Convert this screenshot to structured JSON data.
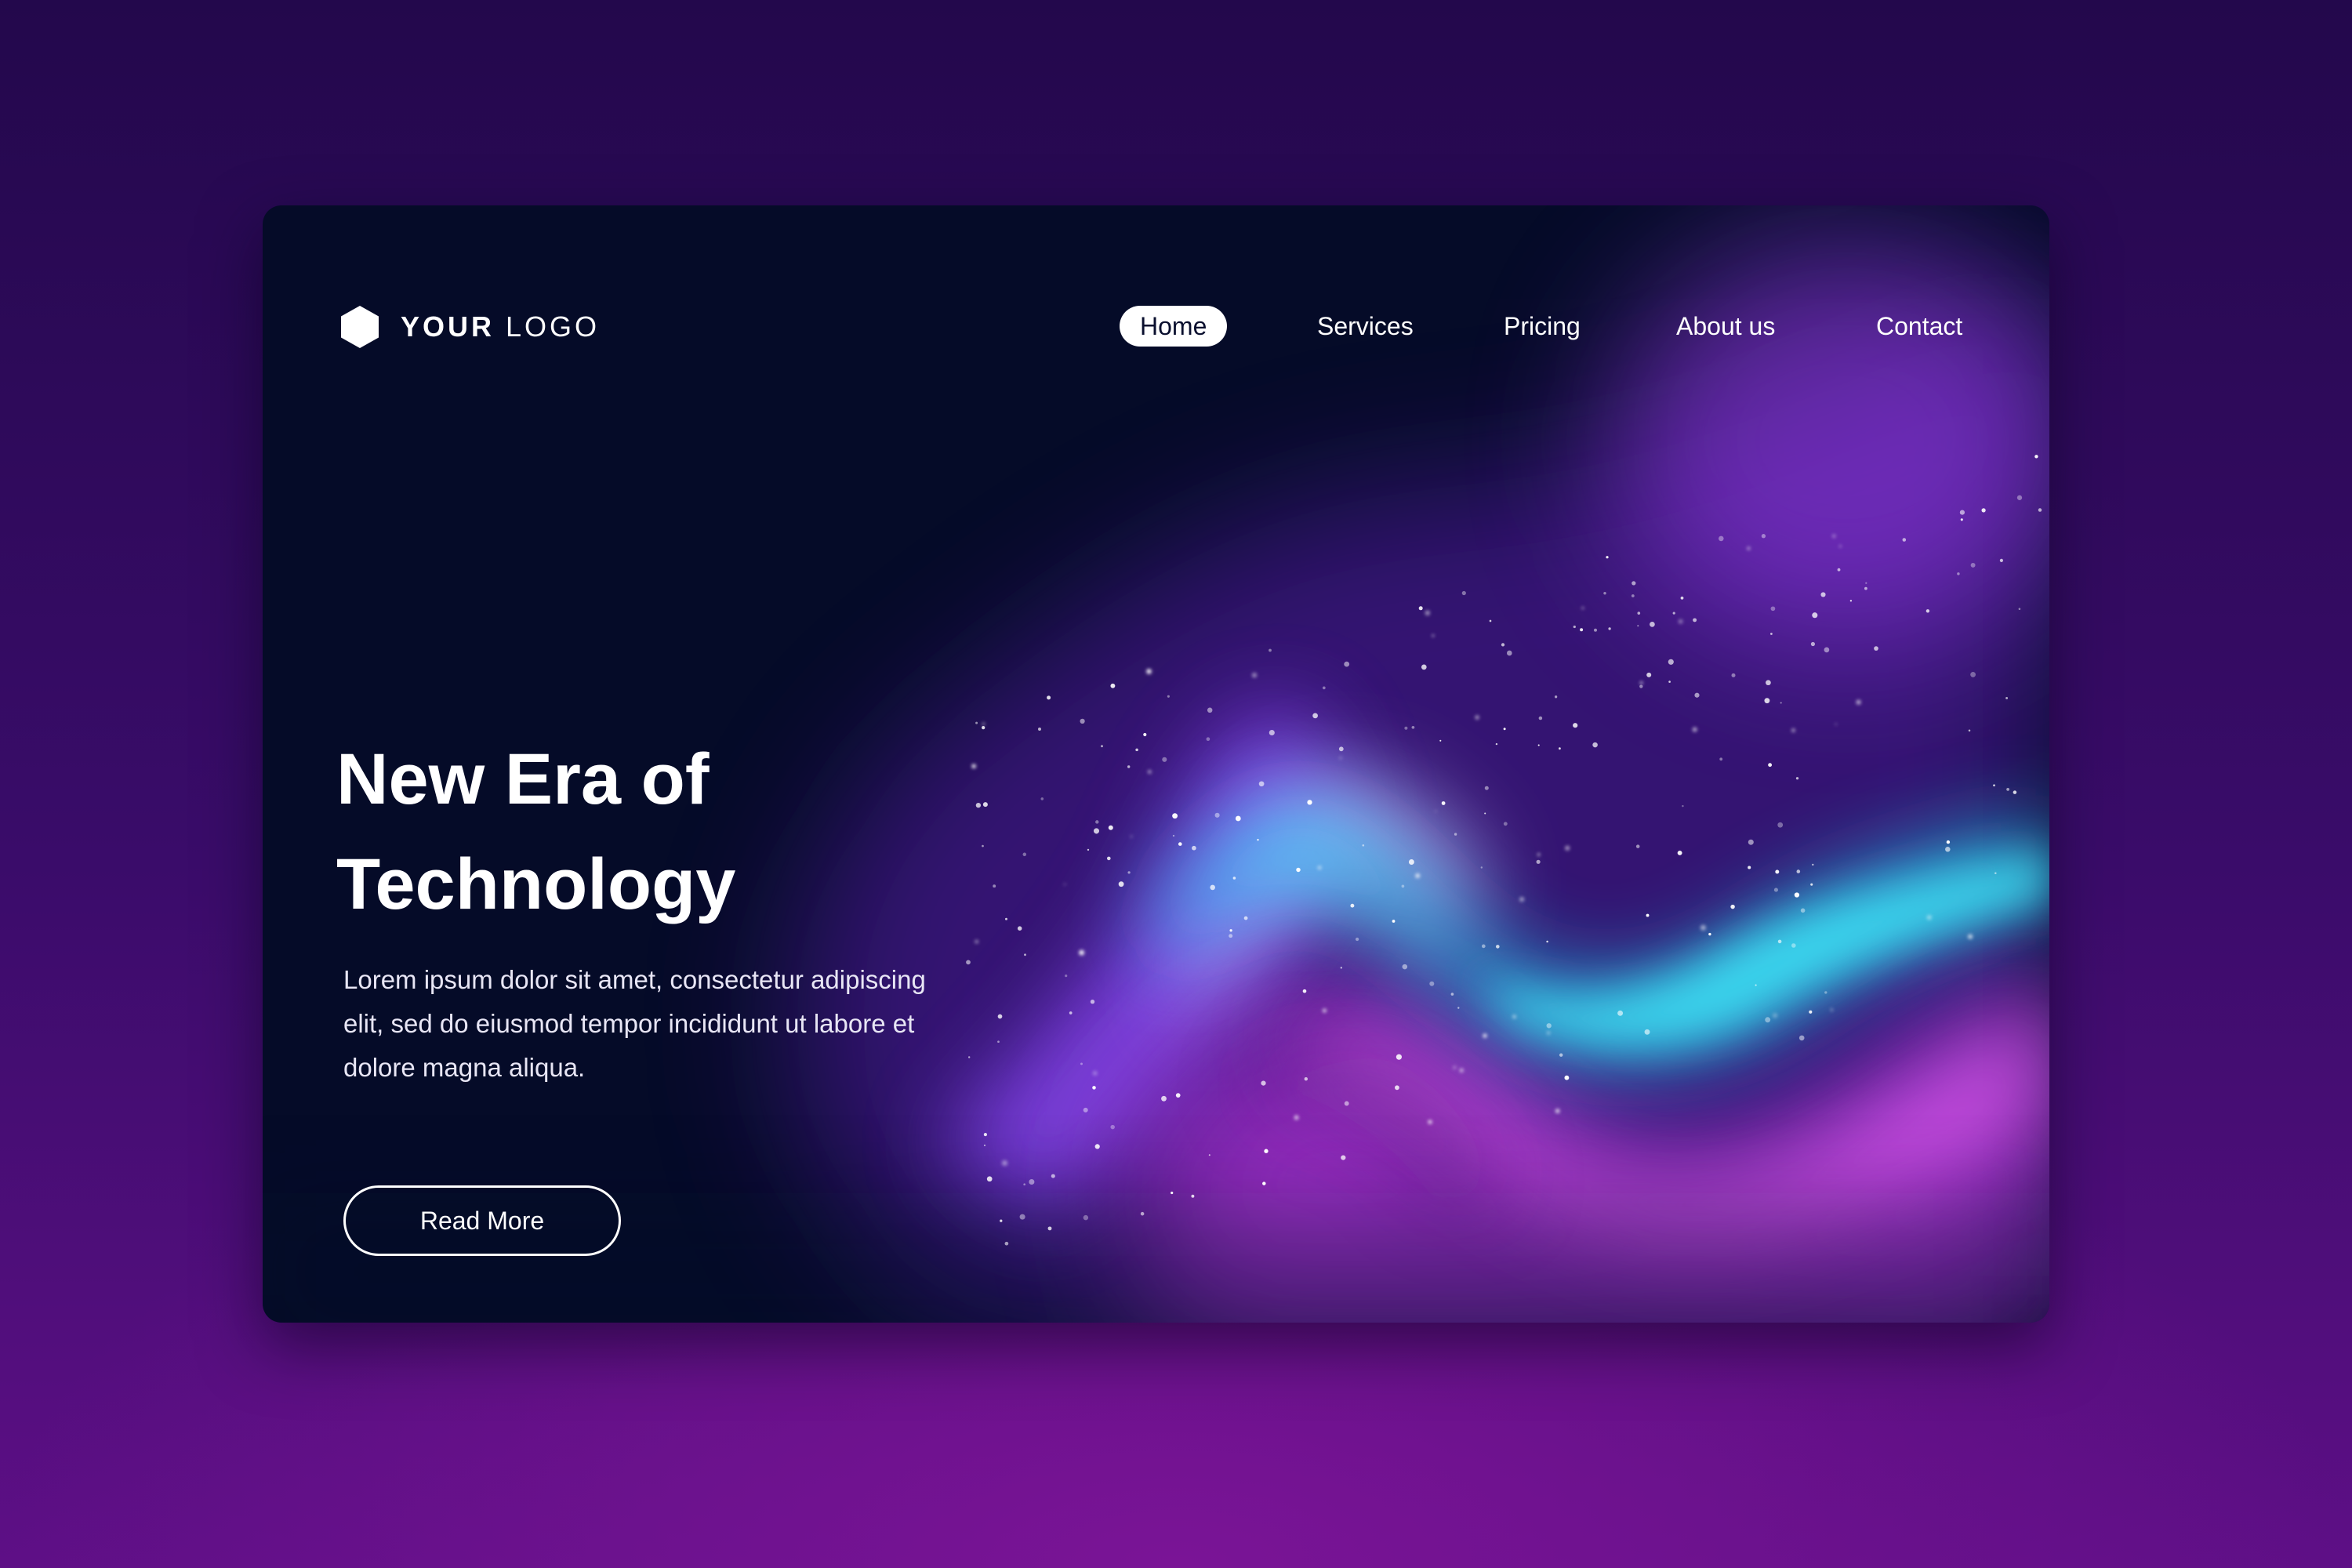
{
  "brand": {
    "logo_bold": "YOUR",
    "logo_light": "LOGO"
  },
  "nav": {
    "items": [
      {
        "label": "Home",
        "active": true
      },
      {
        "label": "Services",
        "active": false
      },
      {
        "label": "Pricing",
        "active": false
      },
      {
        "label": "About us",
        "active": false
      },
      {
        "label": "Contact",
        "active": false
      }
    ]
  },
  "hero": {
    "title_line1": "New Era of",
    "title_line2": "Technology",
    "body_line1": "Lorem ipsum dolor sit amet, consectetur adipiscing",
    "body_line2": "elit, sed do eiusmod tempor incididunt ut labore et",
    "body_line3": "dolore magna aliqua.",
    "cta_label": "Read More"
  },
  "colors": {
    "page_background": "#3a0c6a",
    "card_background": "#050b28",
    "aurora_cyan": "#22e6f5",
    "aurora_purple": "#9b3cf0",
    "aurora_magenta": "#e23bf0",
    "text_primary": "#ffffff"
  },
  "icons": {
    "logo": "hexagon-icon"
  }
}
